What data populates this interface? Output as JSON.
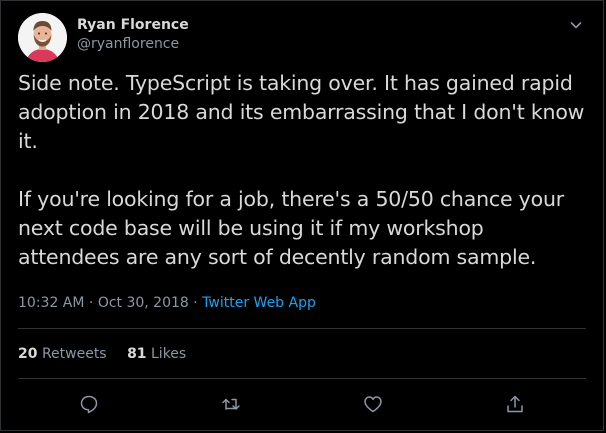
{
  "author": {
    "display_name": "Ryan Florence",
    "handle": "@ryanflorence"
  },
  "tweet": {
    "text": "Side note. TypeScript is taking over. It has gained rapid adoption in 2018 and its embarrassing that I don't know it.\n\nIf you're looking for a job, there's a 50/50 chance your next code base will be using it if my workshop attendees are any sort of decently random sample.",
    "time": "10:32 AM",
    "separator": " · ",
    "date": "Oct 30, 2018",
    "source": "Twitter Web App"
  },
  "stats": {
    "retweets_count": "20",
    "retweets_label": "Retweets",
    "likes_count": "81",
    "likes_label": "Likes"
  },
  "icons": {
    "menu": "chevron-down-icon",
    "reply": "reply-icon",
    "retweet": "retweet-icon",
    "like": "heart-icon",
    "share": "share-icon"
  },
  "colors": {
    "background": "#000000",
    "text": "#d9d9d9",
    "secondary_text": "#8b98a5",
    "link": "#1da1f2",
    "border": "#2f3336"
  }
}
